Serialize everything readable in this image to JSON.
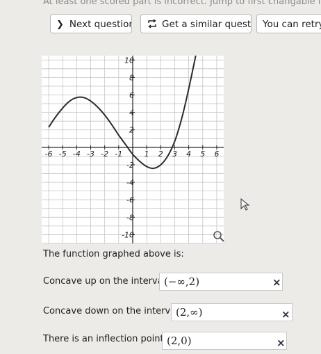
{
  "header": {
    "feedback": "At least one scored part is incorrect. Jump to first changable incorrect part"
  },
  "buttons": {
    "next_question": "Next question",
    "similar_question": "Get a similar question",
    "retry": "You can retry t"
  },
  "chart_data": {
    "type": "line",
    "xlim": [
      -6.5,
      6.5
    ],
    "ylim": [
      -11,
      10.5
    ],
    "grid": true,
    "x_ticks": [
      -6,
      -5,
      -4,
      -3,
      -2,
      -1,
      1,
      2,
      3,
      4,
      5,
      6
    ],
    "y_ticks": [
      -10,
      -8,
      -6,
      -4,
      -2,
      2,
      4,
      6,
      8,
      10
    ],
    "series": [
      {
        "color": "#2b2b2b",
        "x": [
          -6.0,
          -5.5,
          -5.0,
          -4.5,
          -4.0,
          -3.5,
          -3.0,
          -2.5,
          -2.0,
          -1.5,
          -1.0,
          -0.5,
          0.0,
          0.5,
          1.0,
          1.5,
          2.0,
          2.5,
          3.0,
          3.5,
          4.0,
          4.5
        ],
        "y": [
          2.3,
          3.5,
          4.5,
          5.3,
          5.7,
          5.7,
          5.3,
          4.6,
          3.7,
          2.6,
          1.4,
          0.3,
          -0.8,
          -1.6,
          -2.2,
          -2.4,
          -2.0,
          -1.0,
          0.7,
          3.3,
          6.7,
          10.5
        ]
      }
    ]
  },
  "question": {
    "prompt": "The function graphed above is:",
    "rows": [
      {
        "label": "Concave up on the interval(s)",
        "answer": "(−∞,2)",
        "mark": "×"
      },
      {
        "label": "Concave down on the interval(s)",
        "answer": "(2,∞)",
        "mark": "×"
      },
      {
        "label": "There is an inflection point at:",
        "answer": "(2,0)",
        "mark": "×"
      }
    ]
  }
}
